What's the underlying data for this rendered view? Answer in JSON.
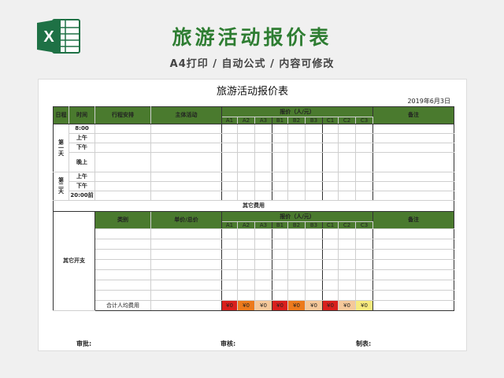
{
  "banner": {
    "title": "旅游活动报价表",
    "subtitle": "A4打印 / 自动公式 / 内容可修改",
    "logo_letter": "X"
  },
  "sheet": {
    "title": "旅游活动报价表",
    "date": "2019年6月3日",
    "headers": {
      "day": "日程",
      "time": "时间",
      "itinerary": "行程安排",
      "activity": "主体活动",
      "quote": "报价（人/元）",
      "remarks": "备注",
      "sub": [
        "A1",
        "A2",
        "A3",
        "B1",
        "B2",
        "B3",
        "C1",
        "C2",
        "C3"
      ]
    },
    "day1_label": "第一天",
    "day2_label": "第二天",
    "times": [
      "8:00",
      "上午",
      "下午",
      "晚上",
      "上午",
      "下午",
      "20:00前"
    ],
    "other_section": "其它费用",
    "other_headers": {
      "category": "类别",
      "unit_total": "单价/总价",
      "quote": "报价（人/元）",
      "remarks": "备注"
    },
    "other_label": "其它开支",
    "total_label": "合计人均费用",
    "totals": [
      "¥0",
      "¥0",
      "¥0",
      "¥0",
      "¥0",
      "¥0",
      "¥0",
      "¥0",
      "¥0"
    ]
  },
  "footer": {
    "approve": "审批:",
    "review": "审核:",
    "prepared": "制表:"
  },
  "colors": {
    "brand_green": "#2e7d32",
    "header_green": "#4a7a2e",
    "red": "#d9201c",
    "orange": "#ec7a1c",
    "peach": "#f5c89a",
    "yellow": "#f7ea7e"
  }
}
